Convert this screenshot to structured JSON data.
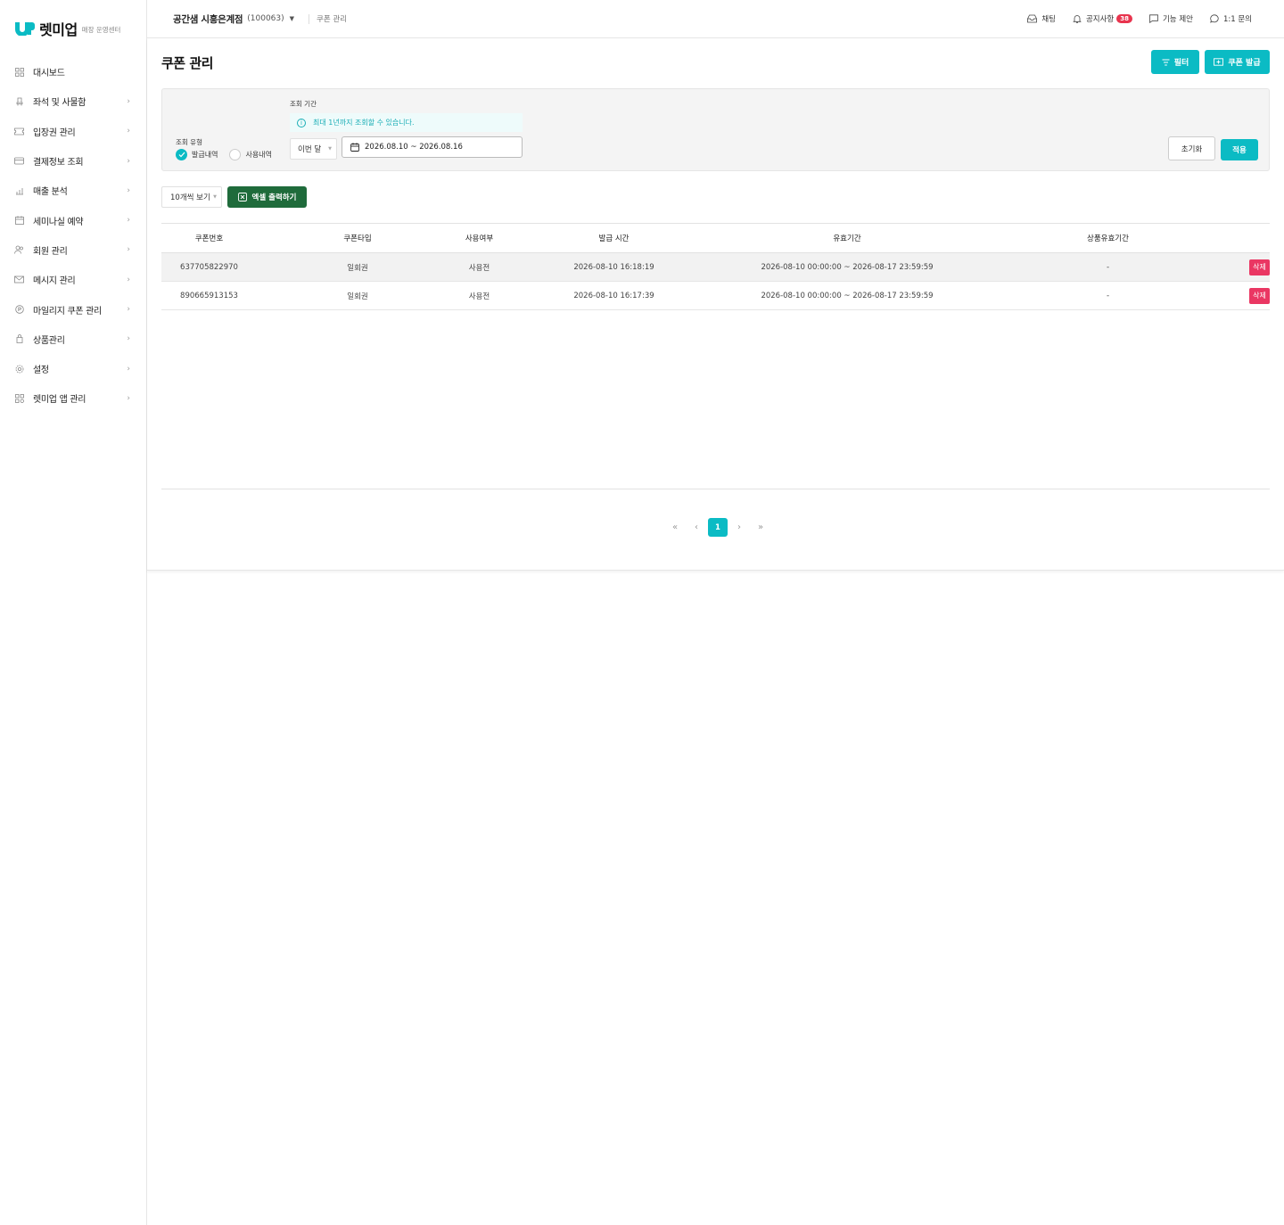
{
  "brand": {
    "name": "렛미업",
    "sub": "매장 운영센터"
  },
  "sidebar": {
    "items": [
      {
        "label": "대시보드",
        "icon": "grid-icon",
        "chevron": ""
      },
      {
        "label": "좌석 및 사물함",
        "icon": "seat-icon",
        "chevron": "›"
      },
      {
        "label": "입장권 관리",
        "icon": "ticket-icon",
        "chevron": "›"
      },
      {
        "label": "결제정보 조회",
        "icon": "card-icon",
        "chevron": "›"
      },
      {
        "label": "매출 분석",
        "icon": "chart-icon",
        "chevron": "›"
      },
      {
        "label": "세미나실 예약",
        "icon": "calendar-icon",
        "chevron": "›"
      },
      {
        "label": "회원 관리",
        "icon": "users-icon",
        "chevron": "›"
      },
      {
        "label": "메시지 관리",
        "icon": "mail-icon",
        "chevron": "›"
      },
      {
        "label": "마일리지 쿠폰 관리",
        "icon": "coin-icon",
        "chevron": "›"
      },
      {
        "label": "상품관리",
        "icon": "box-icon",
        "chevron": "›"
      },
      {
        "label": "설정",
        "icon": "gear-icon",
        "chevron": "›"
      },
      {
        "label": "렛미업 앱 관리",
        "icon": "apps-icon",
        "chevron": "›"
      }
    ]
  },
  "header": {
    "store_name": "공간샘 시흥은계점",
    "store_code": "(100063)",
    "breadcrumb": "쿠폰 관리",
    "chat": "채팅",
    "notice": "공지사항",
    "notice_badge": "38",
    "suggest": "기능 제안",
    "inquiry": "1:1 문의"
  },
  "page": {
    "title": "쿠폰 관리",
    "filter_button": "필터",
    "issue_button": "쿠폰 발급"
  },
  "filter": {
    "type_label": "조회 유형",
    "type_issued": "발급내역",
    "type_used": "사용내역",
    "period_label": "조회 기간",
    "info": "최대 1년까지 조회할 수 있습니다.",
    "period_select": "이번 달",
    "date_range": "2026.08.10 ~ 2026.08.16",
    "reset": "초기화",
    "apply": "적용"
  },
  "toolbar": {
    "page_size": "10개씩 보기",
    "excel": "엑셀 출력하기"
  },
  "table": {
    "headers": [
      "쿠폰번호",
      "쿠폰타입",
      "사용여부",
      "발급 시간",
      "유효기간",
      "상품유효기간",
      ""
    ],
    "rows": [
      {
        "no": "637705822970",
        "type": "일회권",
        "status": "사용전",
        "issued": "2026-08-10 16:18:19",
        "valid": "2026-08-10 00:00:00 ~ 2026-08-17 23:59:59",
        "product_valid": "-",
        "action": "삭제"
      },
      {
        "no": "890665913153",
        "type": "일회권",
        "status": "사용전",
        "issued": "2026-08-10 16:17:39",
        "valid": "2026-08-10 00:00:00 ~ 2026-08-17 23:59:59",
        "product_valid": "-",
        "action": "삭제"
      }
    ]
  },
  "pagination": {
    "first": "«",
    "prev": "‹",
    "current": "1",
    "next": "›",
    "last": "»"
  },
  "colors": {
    "accent": "#0bbbc4",
    "excel": "#1f6b3b",
    "danger": "#ea3763",
    "badge": "#e8344e"
  }
}
